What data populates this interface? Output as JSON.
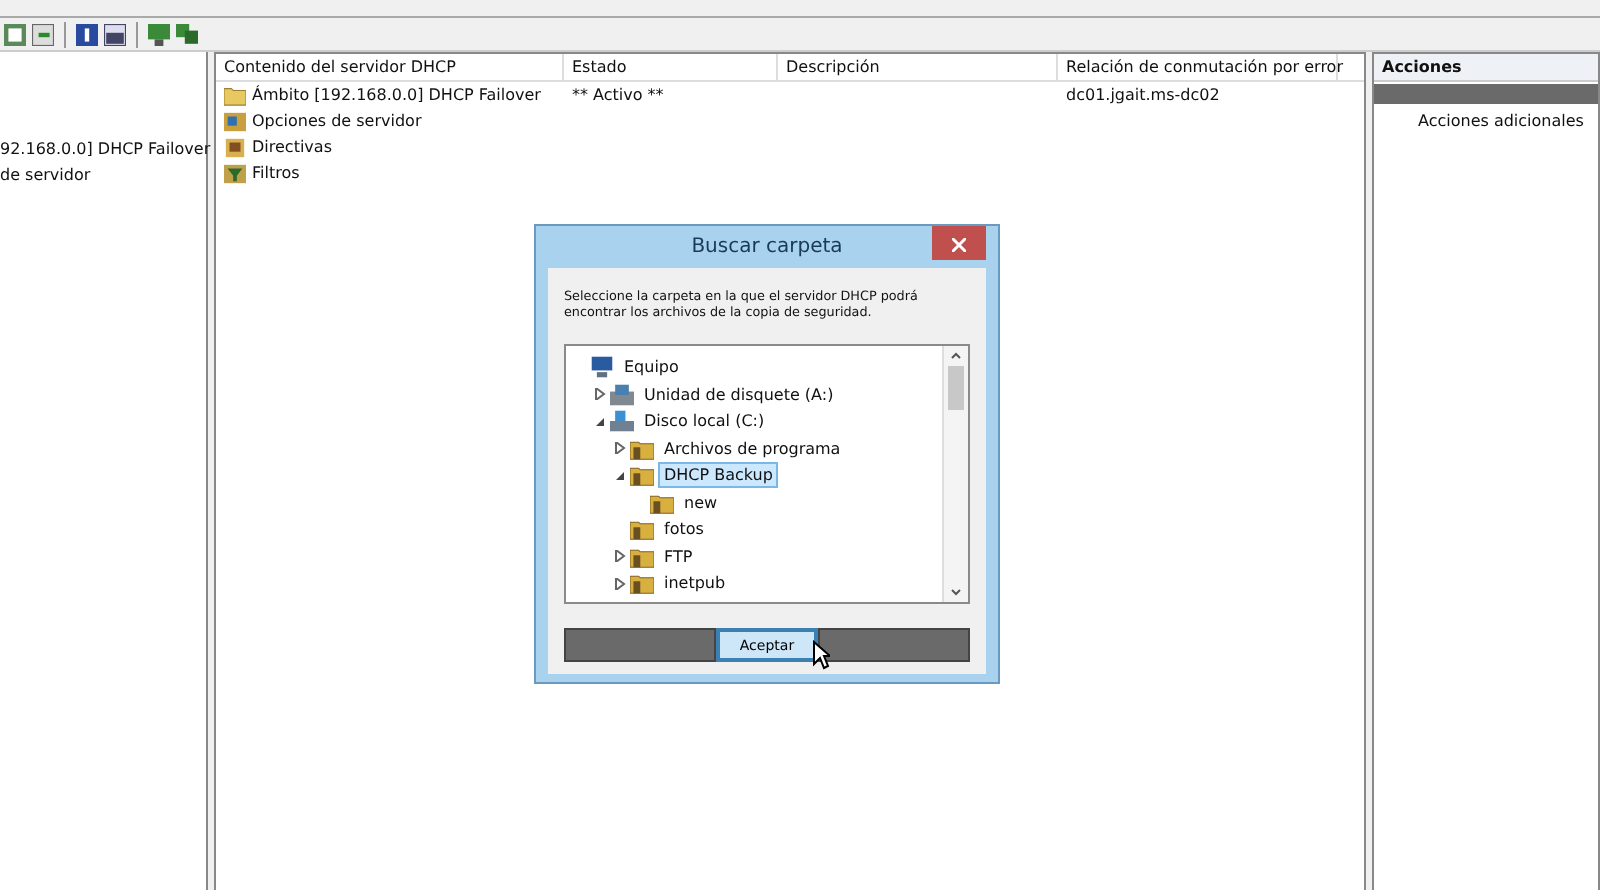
{
  "left_tree": {
    "items": [
      {
        "label": "92.168.0.0] DHCP Failover"
      },
      {
        "label": "de servidor"
      }
    ]
  },
  "content": {
    "columns": [
      "Contenido del servidor DHCP",
      "Estado",
      "Descripción",
      "Relación de conmutación por error"
    ],
    "rows": [
      {
        "kind": "scope",
        "cells": [
          "Ámbito [192.168.0.0] DHCP Failover",
          "** Activo **",
          "",
          "dc01.jgait.ms-dc02"
        ]
      },
      {
        "kind": "options",
        "cells": [
          "Opciones de servidor",
          "",
          "",
          ""
        ]
      },
      {
        "kind": "policies",
        "cells": [
          "Directivas",
          "",
          "",
          ""
        ]
      },
      {
        "kind": "filters",
        "cells": [
          "Filtros",
          "",
          "",
          ""
        ]
      }
    ]
  },
  "actions": {
    "title": "Acciones",
    "items": [
      "Acciones adicionales"
    ]
  },
  "dialog": {
    "title": "Buscar carpeta",
    "message": "Seleccione la carpeta en la que el servidor DHCP podrá encontrar los archivos de la copia de seguridad.",
    "tree": [
      {
        "label": "Equipo",
        "kind": "computer",
        "selected": false,
        "children": [
          {
            "label": "Unidad de disquete (A:)",
            "kind": "floppy",
            "expanded": false,
            "selected": false
          },
          {
            "label": "Disco local (C:)",
            "kind": "drive",
            "expanded": true,
            "selected": false,
            "children": [
              {
                "label": "Archivos de programa",
                "kind": "folder",
                "expanded": false,
                "selected": false
              },
              {
                "label": "DHCP Backup",
                "kind": "folder",
                "expanded": true,
                "selected": true,
                "children": [
                  {
                    "label": "new",
                    "kind": "folder",
                    "selected": false
                  }
                ]
              },
              {
                "label": "fotos",
                "kind": "folder",
                "selected": false
              },
              {
                "label": "FTP",
                "kind": "folder",
                "expanded": false,
                "selected": false
              },
              {
                "label": "inetpub",
                "kind": "folder",
                "expanded": false,
                "selected": false
              }
            ]
          }
        ]
      }
    ],
    "buttons": [
      {
        "kind": "blurred"
      },
      {
        "label": "Aceptar",
        "kind": "default"
      },
      {
        "kind": "blurred"
      }
    ]
  }
}
